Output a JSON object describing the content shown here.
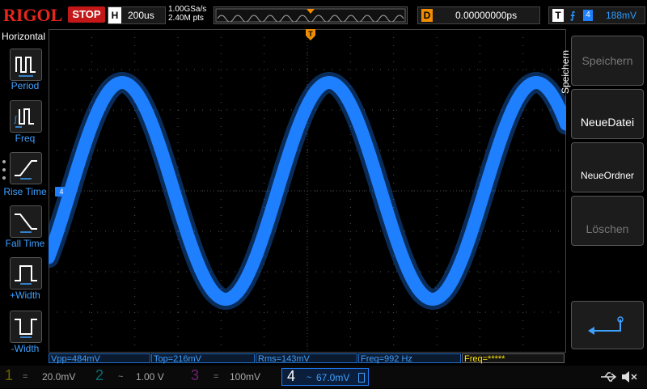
{
  "header": {
    "logo": "RIGOL",
    "run_state": "STOP",
    "horizontal_label": "H",
    "timebase": "200us",
    "sample_rate": "1.00GSa/s",
    "memory_depth": "2.40M pts",
    "delay_label": "D",
    "delay_value": "0.00000000ps",
    "trigger_label": "T",
    "trigger_source": "4",
    "trigger_level": "188mV"
  },
  "left_panel": {
    "title": "Horizontal",
    "items": [
      {
        "label": "Period",
        "icon": "period-icon"
      },
      {
        "label": "Freq",
        "icon": "freq-icon"
      },
      {
        "label": "Rise Time",
        "icon": "rise-time-icon"
      },
      {
        "label": "Fall Time",
        "icon": "fall-time-icon"
      },
      {
        "label": "+Width",
        "icon": "pos-width-icon"
      },
      {
        "label": "-Width",
        "icon": "neg-width-icon"
      }
    ]
  },
  "right_panel": {
    "title": "Speichern",
    "buttons": [
      {
        "label": "Speichern",
        "enabled": false
      },
      {
        "label": "NeueDatei",
        "enabled": true
      },
      {
        "label": "NeueOrdner",
        "enabled": true
      },
      {
        "label": "Löschen",
        "enabled": false
      }
    ],
    "back_icon": "return-arrow-icon"
  },
  "measurements": {
    "vpp": "Vpp=484mV",
    "top": "Top=216mV",
    "rms": "Rms=143mV",
    "freq": "Freq=992 Hz",
    "freq_extra": "Freq=*****"
  },
  "channels": [
    {
      "num": "1",
      "coupling": "=",
      "scale": "20.0mV",
      "color": "#d6c300"
    },
    {
      "num": "2",
      "coupling": "~",
      "scale": "1.00 V",
      "color": "#19c6d6"
    },
    {
      "num": "3",
      "coupling": "=",
      "scale": "100mV",
      "color": "#d04ad0"
    },
    {
      "num": "4",
      "coupling": "~",
      "scale": "67.0mV",
      "color": "#1e7fff"
    }
  ],
  "trace": {
    "channel_marker": "4",
    "color": "#1e7fff",
    "trigger_marker": "T"
  },
  "colors": {
    "accent_blue": "#1e7fff",
    "stop_red": "#c41818",
    "trigger_orange": "#f08c00"
  }
}
